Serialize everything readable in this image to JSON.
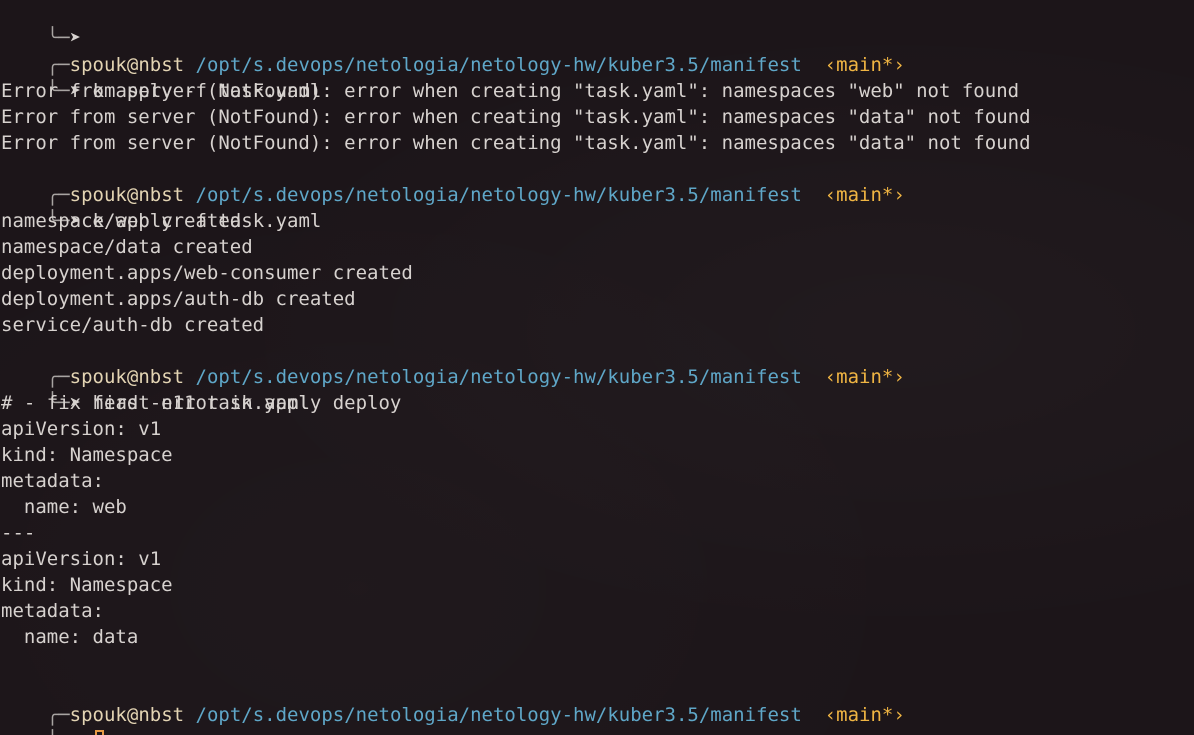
{
  "colors": {
    "background": "#1c1519",
    "path": "#5fa7c8",
    "branch": "#f0b543",
    "text": "#d7d2cf",
    "cursor": "#e79a45"
  },
  "prompt": {
    "corner_top": "╭─",
    "corner_bottom": "╰─",
    "arrow": "➤",
    "user": "spouk",
    "at": "@",
    "host": "nbst",
    "path": "/opt/s.devops/netologia/netology-hw/kuber3.5/manifest",
    "branch": "‹main*›"
  },
  "blocks": [
    {
      "command": "k apply -f task.yaml",
      "output": [
        "Error from server (NotFound): error when creating \"task.yaml\": namespaces \"web\" not found",
        "Error from server (NotFound): error when creating \"task.yaml\": namespaces \"data\" not found",
        "Error from server (NotFound): error when creating \"task.yaml\": namespaces \"data\" not found"
      ]
    },
    {
      "command": "k apply -f task.yaml",
      "output": [
        "namespace/web created",
        "namespace/data created",
        "deployment.apps/web-consumer created",
        "deployment.apps/auth-db created",
        "service/auth-db created"
      ]
    },
    {
      "command": "head -n11 task.yaml",
      "output": [
        "# - fix first error in apply deploy",
        "apiVersion: v1",
        "kind: Namespace",
        "metadata:",
        "  name: web",
        "---",
        "apiVersion: v1",
        "kind: Namespace",
        "metadata:",
        "  name: data",
        ""
      ]
    }
  ],
  "current_command": ""
}
